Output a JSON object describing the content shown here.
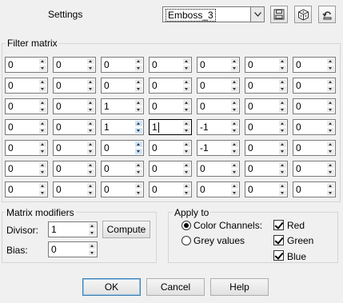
{
  "header": {
    "settings_label": "Settings",
    "preset_value": "Emboss_3"
  },
  "filter_matrix": {
    "title": "Filter matrix",
    "rows": [
      [
        "0",
        "0",
        "0",
        "0",
        "0",
        "0",
        "0"
      ],
      [
        "0",
        "0",
        "0",
        "0",
        "0",
        "0",
        "0"
      ],
      [
        "0",
        "0",
        "1",
        "0",
        "0",
        "0",
        "0"
      ],
      [
        "0",
        "0",
        "1",
        "1",
        "-1",
        "0",
        "0"
      ],
      [
        "0",
        "0",
        "0",
        "0",
        "-1",
        "0",
        "0"
      ],
      [
        "0",
        "0",
        "0",
        "0",
        "0",
        "0",
        "0"
      ],
      [
        "0",
        "0",
        "0",
        "0",
        "0",
        "0",
        "0"
      ]
    ]
  },
  "modifiers": {
    "title": "Matrix modifiers",
    "divisor_label": "Divisor:",
    "divisor_value": "1",
    "compute_label": "Compute",
    "bias_label": "Bias:",
    "bias_value": "0"
  },
  "apply_to": {
    "title": "Apply to",
    "color_channels_label": "Color Channels:",
    "grey_values_label": "Grey values",
    "selected": "color",
    "red_label": "Red",
    "green_label": "Green",
    "blue_label": "Blue",
    "red_checked": true,
    "green_checked": true,
    "blue_checked": true
  },
  "footer": {
    "ok_label": "OK",
    "cancel_label": "Cancel",
    "help_label": "Help"
  },
  "icons": [
    "chevron-down-icon",
    "save-preset-icon",
    "randomize-dice-icon",
    "reset-icon"
  ]
}
